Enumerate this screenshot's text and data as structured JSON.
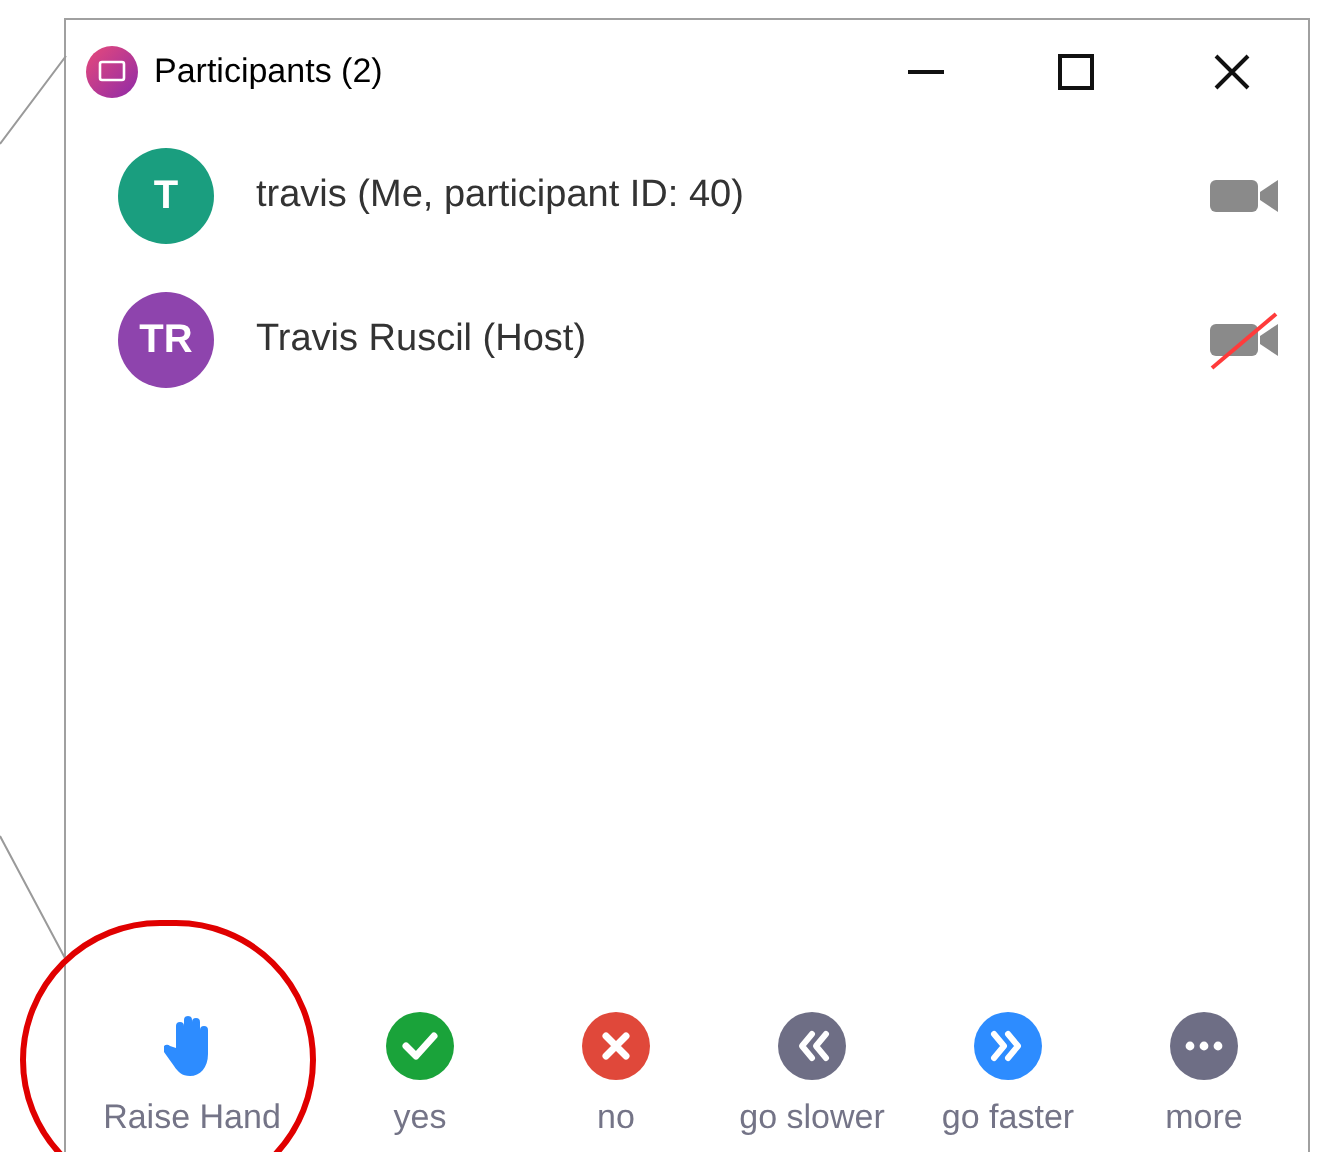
{
  "window": {
    "title": "Participants (2)"
  },
  "participants": [
    {
      "initials": "T",
      "name": "travis (Me, participant ID: 40)",
      "color": "#1a9e7f",
      "video_on": true
    },
    {
      "initials": "TR",
      "name": "Travis Ruscil (Host)",
      "color": "#8e44ad",
      "video_on": false
    }
  ],
  "reactions": [
    {
      "kind": "hand",
      "label": "Raise Hand",
      "highlighted": true
    },
    {
      "kind": "yes",
      "label": "yes",
      "highlighted": false
    },
    {
      "kind": "no",
      "label": "no",
      "highlighted": false
    },
    {
      "kind": "slower",
      "label": "go slower",
      "highlighted": false
    },
    {
      "kind": "faster",
      "label": "go faster",
      "highlighted": false
    },
    {
      "kind": "more",
      "label": "more",
      "highlighted": false
    }
  ]
}
